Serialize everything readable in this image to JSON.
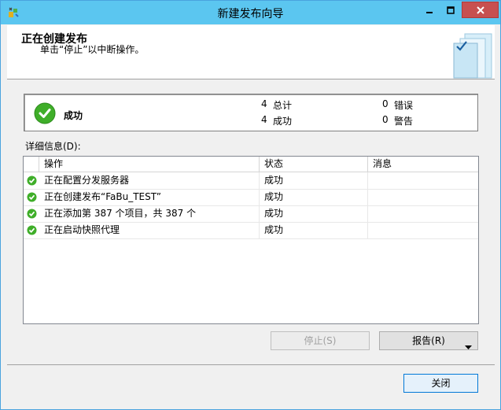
{
  "window": {
    "title": "新建发布向导"
  },
  "header": {
    "title": "正在创建发布",
    "subtitle": "单击“停止”以中断操作。"
  },
  "status": {
    "label": "成功",
    "total_count": "4",
    "total_label": "总计",
    "success_count": "4",
    "success_label": "成功",
    "error_count": "0",
    "error_label": "错误",
    "warning_count": "0",
    "warning_label": "警告"
  },
  "details": {
    "label": "详细信息(D):",
    "columns": [
      "操作",
      "状态",
      "消息"
    ],
    "rows": [
      {
        "action": "正在配置分发服务器",
        "status": "成功",
        "message": ""
      },
      {
        "action": "正在创建发布“FaBu_TEST”",
        "status": "成功",
        "message": ""
      },
      {
        "action": "正在添加第 387 个项目，共 387 个",
        "status": "成功",
        "message": ""
      },
      {
        "action": "正在启动快照代理",
        "status": "成功",
        "message": ""
      }
    ]
  },
  "buttons": {
    "stop": "停止(S)",
    "report": "报告(R)",
    "close": "关闭"
  },
  "colors": {
    "titlebar": "#5bc6f0",
    "success": "#3fae29"
  },
  "icons": {
    "success": "check-circle-icon",
    "app": "wizard-app-icon"
  }
}
